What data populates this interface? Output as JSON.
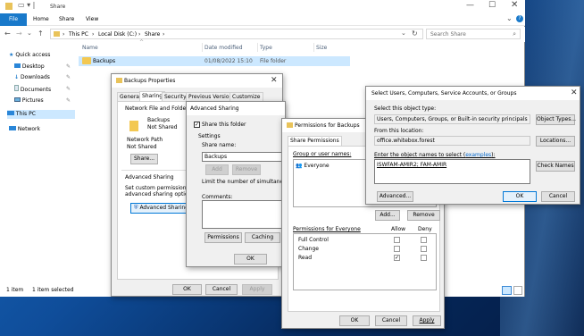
{
  "explorer": {
    "title": "Share",
    "ribbon_tabs": [
      "File",
      "Home",
      "Share",
      "View"
    ],
    "address": [
      "This PC",
      "Local Disk (C:)",
      "Share"
    ],
    "search_placeholder": "Search Share",
    "columns": [
      "Name",
      "Date modified",
      "Type",
      "Size"
    ],
    "files": [
      {
        "name": "Backups",
        "date": "01/08/2022 15:10",
        "type": "File folder",
        "size": ""
      }
    ],
    "nav": {
      "quick_access": "Quick access",
      "desktop": "Desktop",
      "downloads": "Downloads",
      "documents": "Documents",
      "pictures": "Pictures",
      "this_pc": "This PC",
      "network": "Network"
    },
    "status": {
      "items": "1 item",
      "selected": "1 item selected"
    }
  },
  "props": {
    "title": "Backups Properties",
    "tabs": [
      "General",
      "Sharing",
      "Security",
      "Previous Versions",
      "Customize"
    ],
    "group_title": "Network File and Folder Sha",
    "folder_name": "Backups",
    "folder_state": "Not Shared",
    "net_path_label": "Network Path",
    "net_path": "Not Shared",
    "share_btn": "Share...",
    "adv_title": "Advanced Sharing",
    "adv_desc1": "Set custom permissions, cre",
    "adv_desc2": "advanced sharing options.",
    "adv_btn": "Advanced Sharing...",
    "ok": "OK",
    "cancel": "Cancel",
    "apply": "Apply"
  },
  "adv": {
    "title": "Advanced Sharing",
    "share_chk": "Share this folder",
    "settings": "Settings",
    "share_name_label": "Share name:",
    "share_name": "Backups",
    "add": "Add",
    "remove": "Remove",
    "limit": "Limit the number of simultaneous us",
    "comments": "Comments:",
    "permissions": "Permissions",
    "caching": "Caching",
    "ok": "OK"
  },
  "perm": {
    "title": "Permissions for Backups",
    "tab": "Share Permissions",
    "group_label": "Group or user names:",
    "users": [
      "Everyone"
    ],
    "add": "Add...",
    "remove": "Remove",
    "perm_for": "Permissions for Everyone",
    "allow": "Allow",
    "deny": "Deny",
    "rows": [
      {
        "name": "Full Control",
        "allow": "",
        "deny": ""
      },
      {
        "name": "Change",
        "allow": "",
        "deny": ""
      },
      {
        "name": "Read",
        "allow": "✓",
        "deny": ""
      }
    ],
    "ok": "OK",
    "cancel": "Cancel",
    "apply": "Apply"
  },
  "select": {
    "title": "Select Users, Computers, Service Accounts, or Groups",
    "type_label": "Select this object type:",
    "type_value": "Users, Computers, Groups, or Built-in security principals",
    "object_types": "Object Types...",
    "location_label": "From this location:",
    "location_value": "office.whitebox.forest",
    "locations": "Locations...",
    "names_label": "Enter the object names to select (",
    "examples": "examples",
    "names_label_end": "):",
    "names_value": "ISWFAM-AMIR2; FAM-AMIR",
    "check_names": "Check Names",
    "advanced": "Advanced...",
    "ok": "OK",
    "cancel": "Cancel"
  }
}
